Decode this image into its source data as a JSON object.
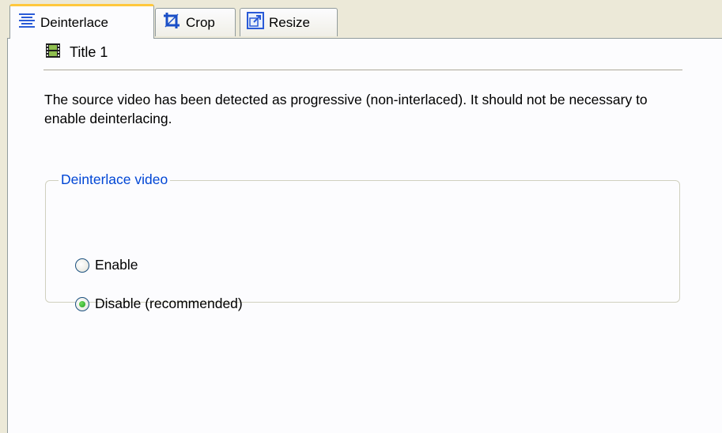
{
  "tabs": [
    {
      "label": "Deinterlace",
      "icon": "align-lines-icon",
      "active": true
    },
    {
      "label": "Crop",
      "icon": "crop-icon",
      "active": false
    },
    {
      "label": "Resize",
      "icon": "resize-icon",
      "active": false
    }
  ],
  "page": {
    "title": "Title 1",
    "message": "The source video has been detected as progressive (non-interlaced). It should not be necessary to enable deinterlacing.",
    "group": {
      "legend": "Deinterlace video",
      "options": [
        {
          "label": "Enable",
          "checked": false
        },
        {
          "label": "Disable (recommended)",
          "checked": true
        }
      ]
    }
  },
  "colors": {
    "accent_tab": "#ffc83c",
    "legend_text": "#0046d5",
    "radio_check": "#21a121"
  }
}
